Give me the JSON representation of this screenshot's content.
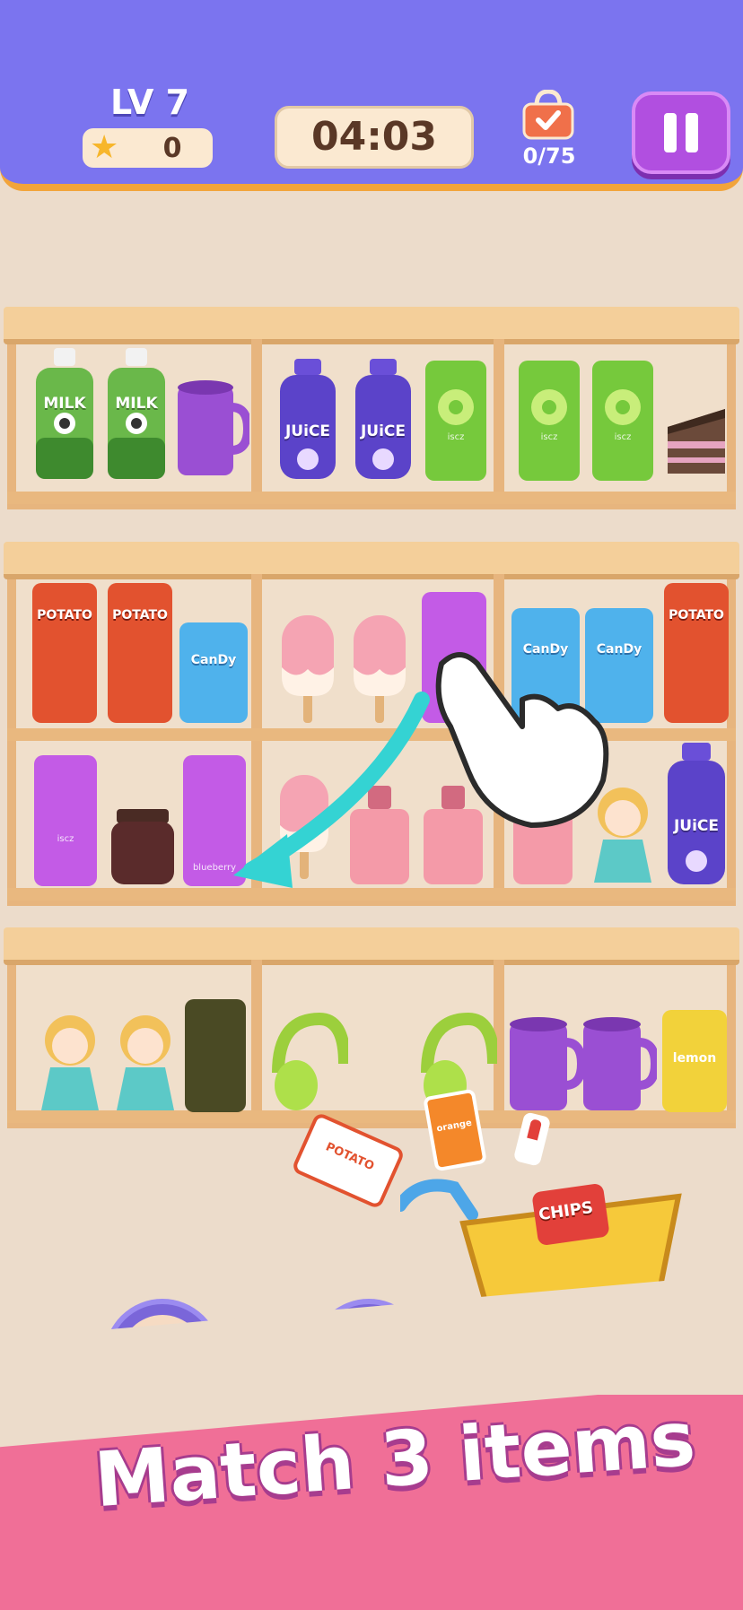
{
  "hud": {
    "level_label": "LV 7",
    "stars": "0",
    "timer": "04:03",
    "goal_progress": "0/75",
    "icons": [
      "star-icon",
      "shopping-bag-icon",
      "pause-icon"
    ]
  },
  "shelves": {
    "row1": [
      "MILK",
      "MILK",
      "JUiCE",
      "JUiCE"
    ],
    "row2": [
      "POTATO",
      "POTATO",
      "CanDy",
      "CanDy",
      "CanDy",
      "POTATO"
    ],
    "row3": [
      "JUiCE"
    ],
    "can_labels": {
      "lime": "lime",
      "blueberry": "blueberry",
      "brand": "iscz",
      "lemon": "lemon"
    }
  },
  "cart": {
    "chips_label": "CHIPS"
  },
  "floating": {
    "orange_can": "orange",
    "potato_chips": "POTATO"
  },
  "tagline": "Match 3 items",
  "colors": {
    "hud_bg": "#7b74ef",
    "pause_bg": "#b14fe0",
    "shelf_wood": "#e7b57e",
    "banner_pink": "#f06f97",
    "timer_text": "#5a3826"
  }
}
